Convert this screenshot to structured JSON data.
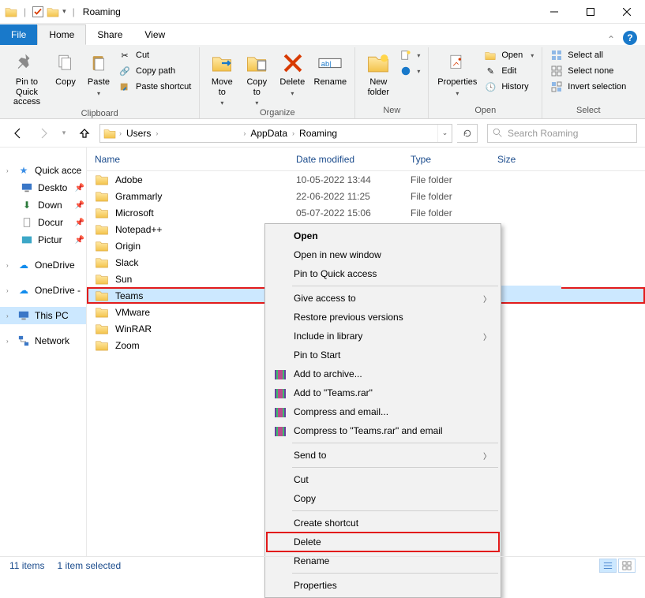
{
  "window": {
    "title": "Roaming"
  },
  "tabs": {
    "file": "File",
    "home": "Home",
    "share": "Share",
    "view": "View"
  },
  "ribbon": {
    "clipboard": {
      "label": "Clipboard",
      "pin": "Pin to Quick\naccess",
      "copy": "Copy",
      "paste": "Paste",
      "cut": "Cut",
      "copy_path": "Copy path",
      "paste_shortcut": "Paste shortcut"
    },
    "organize": {
      "label": "Organize",
      "move_to": "Move\nto",
      "copy_to": "Copy\nto",
      "delete": "Delete",
      "rename": "Rename"
    },
    "new": {
      "label": "New",
      "new_folder": "New\nfolder"
    },
    "open": {
      "label": "Open",
      "properties": "Properties",
      "open": "Open",
      "edit": "Edit",
      "history": "History"
    },
    "select": {
      "label": "Select",
      "select_all": "Select all",
      "select_none": "Select none",
      "invert": "Invert selection"
    }
  },
  "breadcrumbs": [
    "Users",
    "",
    "AppData",
    "Roaming"
  ],
  "search": {
    "placeholder": "Search Roaming"
  },
  "columns": {
    "name": "Name",
    "date": "Date modified",
    "type": "Type",
    "size": "Size"
  },
  "sidebar": {
    "quick": "Quick acce",
    "desktop": "Deskto",
    "downloads": "Down",
    "documents": "Docur",
    "pictures": "Pictur",
    "onedrive": "OneDrive",
    "onedrive2": "OneDrive -",
    "thispc": "This PC",
    "network": "Network"
  },
  "rows": [
    {
      "name": "Adobe",
      "date": "10-05-2022 13:44",
      "type": "File folder"
    },
    {
      "name": "Grammarly",
      "date": "22-06-2022 11:25",
      "type": "File folder"
    },
    {
      "name": "Microsoft",
      "date": "05-07-2022 15:06",
      "type": "File folder"
    },
    {
      "name": "Notepad++",
      "date": "",
      "type": ""
    },
    {
      "name": "Origin",
      "date": "",
      "type": ""
    },
    {
      "name": "Slack",
      "date": "",
      "type": ""
    },
    {
      "name": "Sun",
      "date": "",
      "type": ""
    },
    {
      "name": "Teams",
      "date": "",
      "type": "",
      "selected": true
    },
    {
      "name": "VMware",
      "date": "",
      "type": ""
    },
    {
      "name": "WinRAR",
      "date": "",
      "type": ""
    },
    {
      "name": "Zoom",
      "date": "",
      "type": ""
    }
  ],
  "context_menu": {
    "open": "Open",
    "open_new_window": "Open in new window",
    "pin_quick": "Pin to Quick access",
    "give_access": "Give access to",
    "restore_prev": "Restore previous versions",
    "include_library": "Include in library",
    "pin_start": "Pin to Start",
    "add_archive": "Add to archive...",
    "add_teams_rar": "Add to \"Teams.rar\"",
    "compress_email": "Compress and email...",
    "compress_teams_email": "Compress to \"Teams.rar\" and email",
    "send_to": "Send to",
    "cut": "Cut",
    "copy": "Copy",
    "create_shortcut": "Create shortcut",
    "delete": "Delete",
    "rename": "Rename",
    "properties": "Properties"
  },
  "status": {
    "items": "11 items",
    "selected": "1 item selected"
  }
}
